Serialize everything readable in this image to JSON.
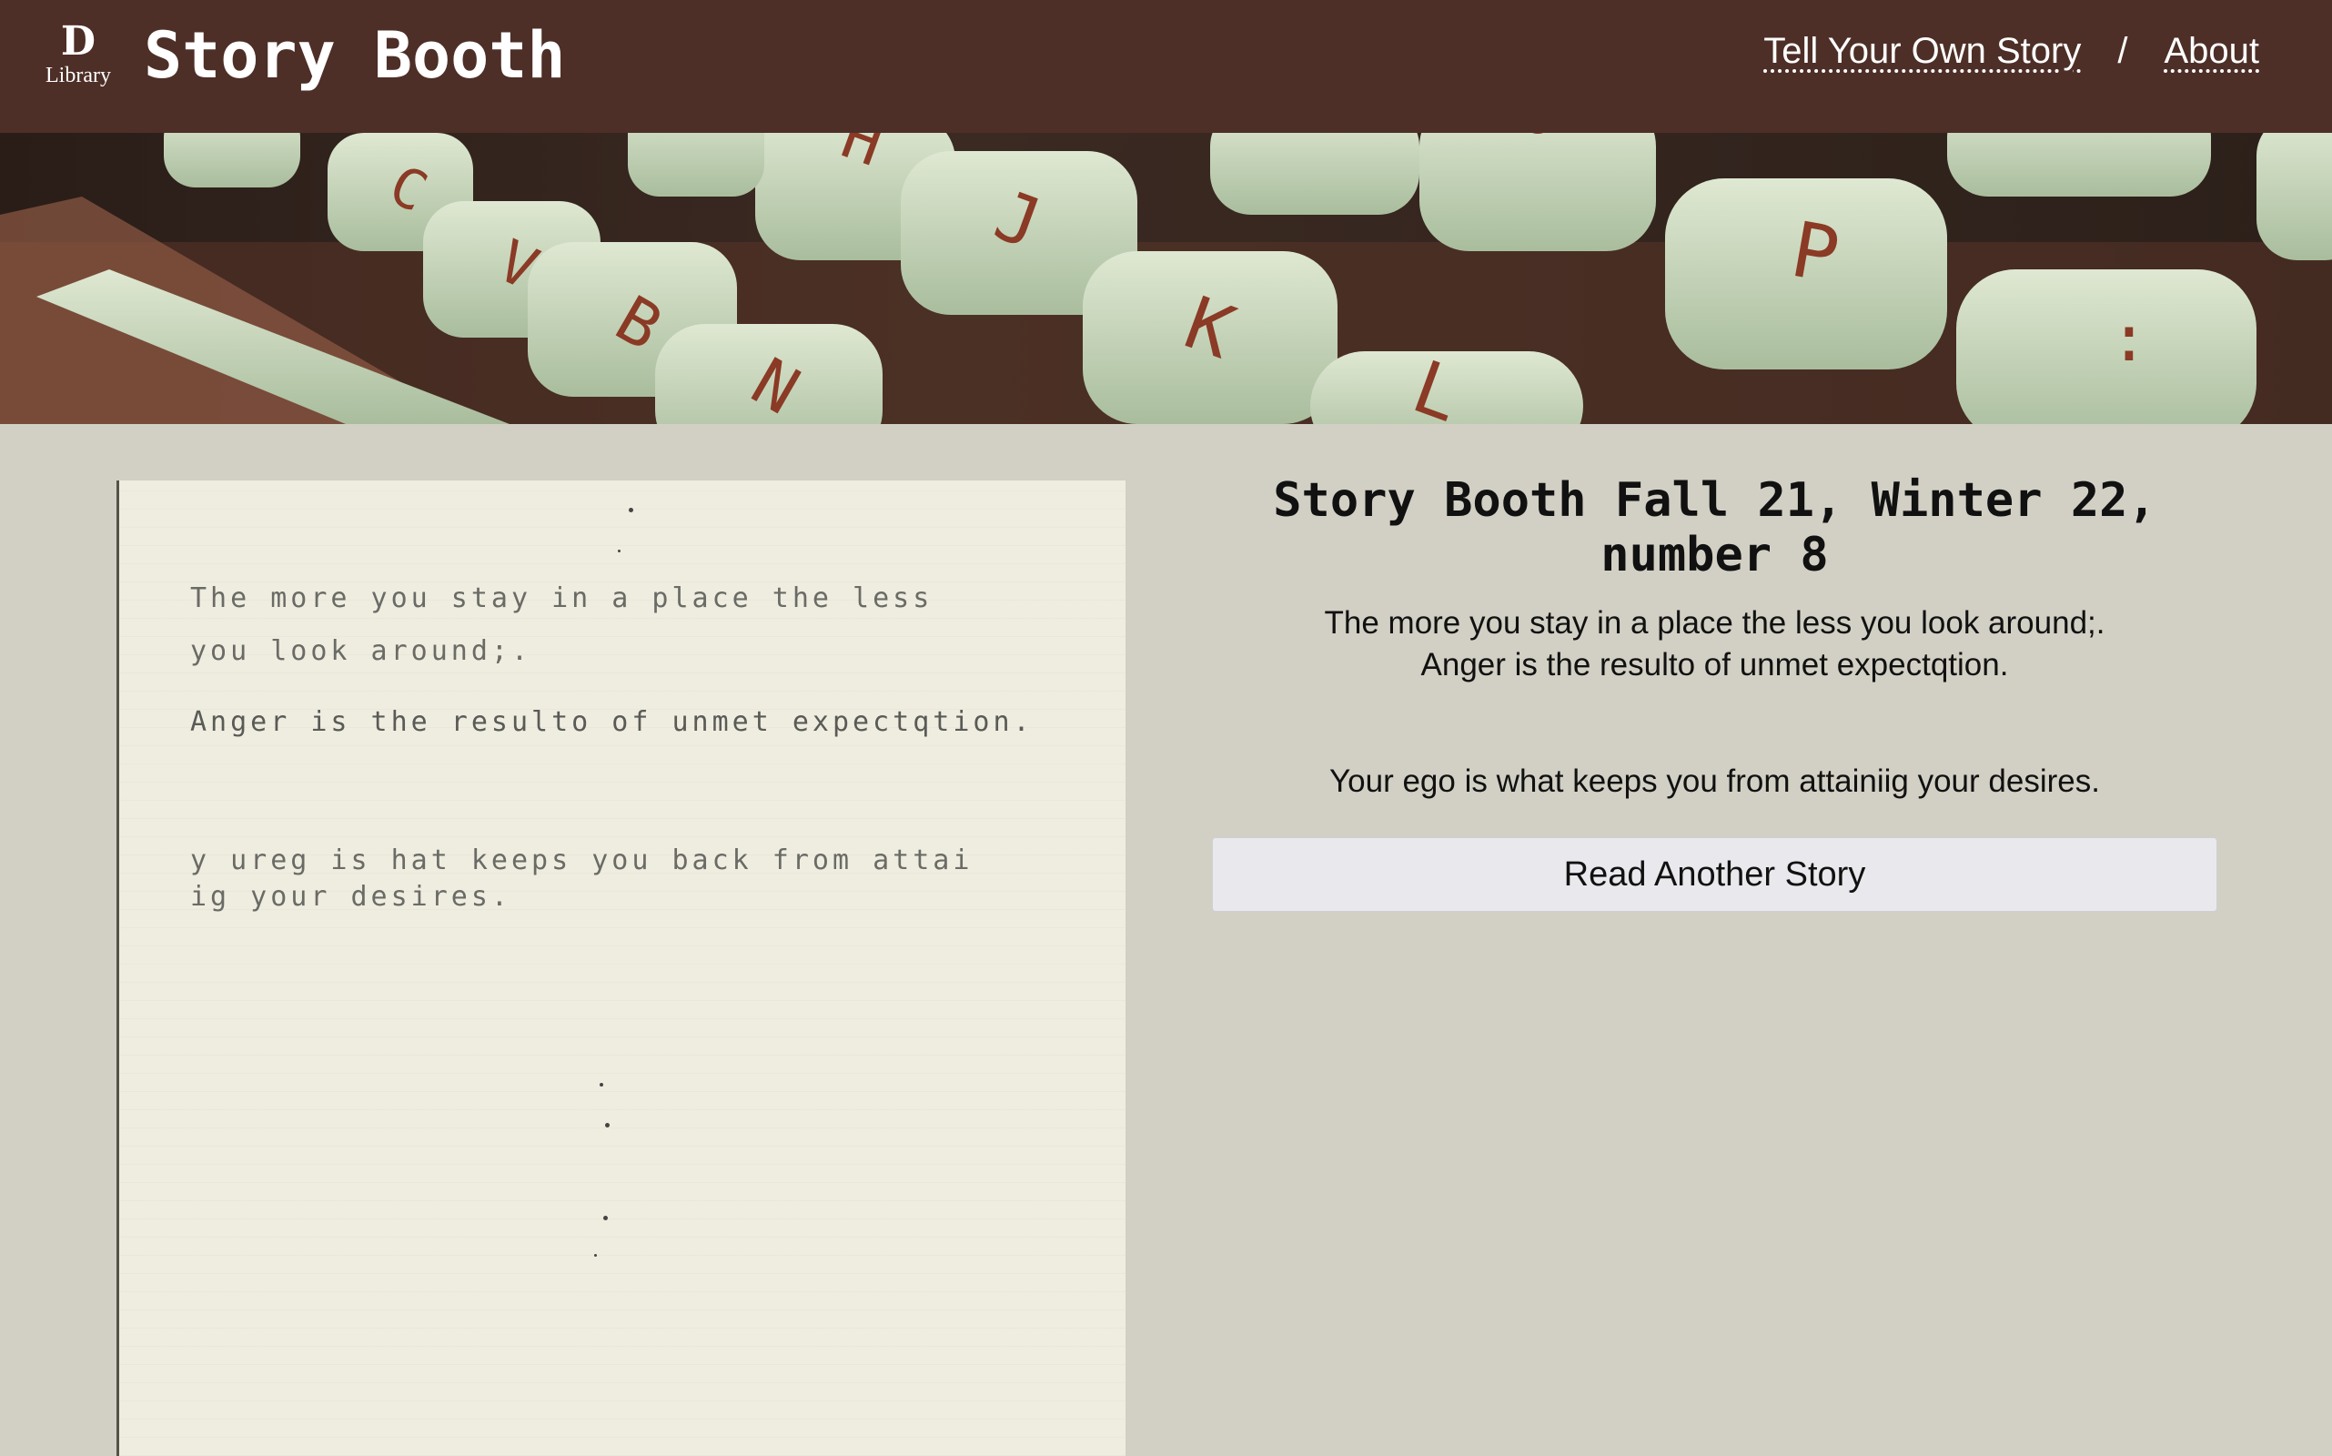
{
  "header": {
    "logo_mark": "D",
    "logo_label": "Library",
    "site_title": "Story Booth",
    "nav": {
      "tell_story": "Tell Your Own Story",
      "separator": "/",
      "about": "About"
    }
  },
  "banner": {
    "keys": [
      "C",
      "V",
      "B",
      "N",
      "H",
      "J",
      "K",
      "L",
      "P",
      ":",
      "O"
    ]
  },
  "scan": {
    "lines": [
      "The more you stay in a place the less",
      "you look around;.",
      "Anger is the resulto of unmet expectqtion.",
      "y ureg is hat keeps you back from attai",
      "ig your desires."
    ]
  },
  "story": {
    "title": "Story Booth Fall 21, Winter 22, number 8",
    "line1": "The more you stay in a place the less you look around;.",
    "line2": "Anger is the resulto of unmet expectqtion.",
    "line3": "Your ego is what keeps you from attainiig your desires.",
    "button_label": "Read Another Story"
  },
  "colors": {
    "header_bg": "#4d2f27",
    "page_bg": "#d2d0c4",
    "paper_bg": "#efede0",
    "key_color": "#c9d9be",
    "key_letter": "#8a3a25"
  }
}
